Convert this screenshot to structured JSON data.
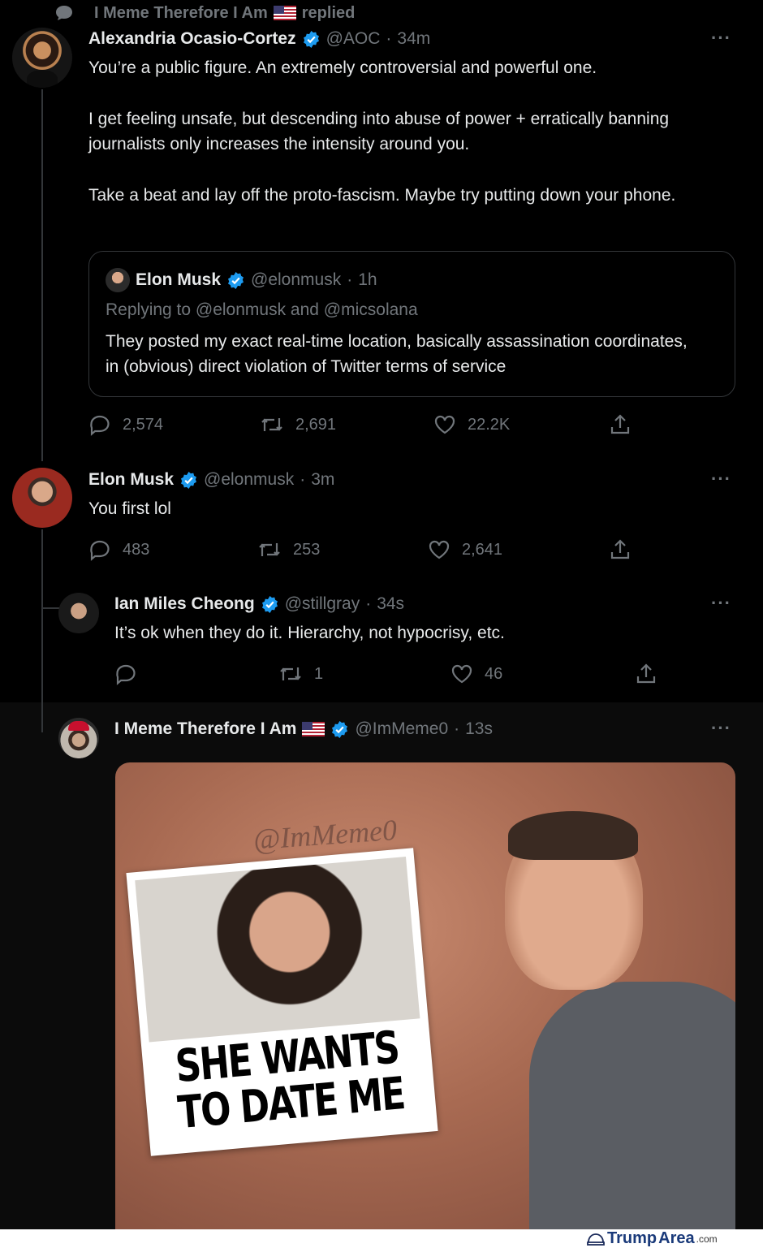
{
  "context": {
    "text": "I Meme Therefore I Am",
    "suffix": "replied"
  },
  "aoc_tweet": {
    "name": "Alexandria Ocasio-Cortez",
    "handle": "@AOC",
    "time": "34m",
    "para1": "You’re a public figure. An extremely controversial and powerful one.",
    "para2": "I get feeling unsafe, but descending into abuse of power + erratically banning journalists only increases the intensity around you.",
    "para3": "Take a beat and lay off the proto-fascism. Maybe try putting down your phone.",
    "quote": {
      "name": "Elon Musk",
      "handle": "@elonmusk",
      "time": "1h",
      "replying": "Replying to @elonmusk and @micsolana",
      "text": "They posted my exact real-time location, basically assassination coordinates, in (obvious) direct violation of Twitter terms of service"
    },
    "replies": "2,574",
    "retweets": "2,691",
    "likes": "22.2K"
  },
  "musk_tweet": {
    "name": "Elon Musk",
    "handle": "@elonmusk",
    "time": "3m",
    "text": "You first lol",
    "replies": "483",
    "retweets": "253",
    "likes": "2,641"
  },
  "ian_tweet": {
    "name": "Ian Miles Cheong",
    "handle": "@stillgray",
    "time": "34s",
    "text": "It’s ok when they do it. Hierarchy, not hypocrisy, etc.",
    "replies": "",
    "retweets": "1",
    "likes": "46"
  },
  "meme_tweet": {
    "name": "I Meme Therefore I Am",
    "handle": "@ImMeme0",
    "time": "13s",
    "watermark": "@ImMeme0",
    "sign_line1": "SHE WANTS",
    "sign_line2": "TO DATE ME"
  },
  "footer": {
    "brand1": "Trump",
    "brand2": "Area",
    "brand3": ".com"
  },
  "colors": {
    "background": "#000000",
    "verified": "#1d9bf0",
    "muted": "#71767b",
    "highlight_bg": "#0b0b0b"
  }
}
